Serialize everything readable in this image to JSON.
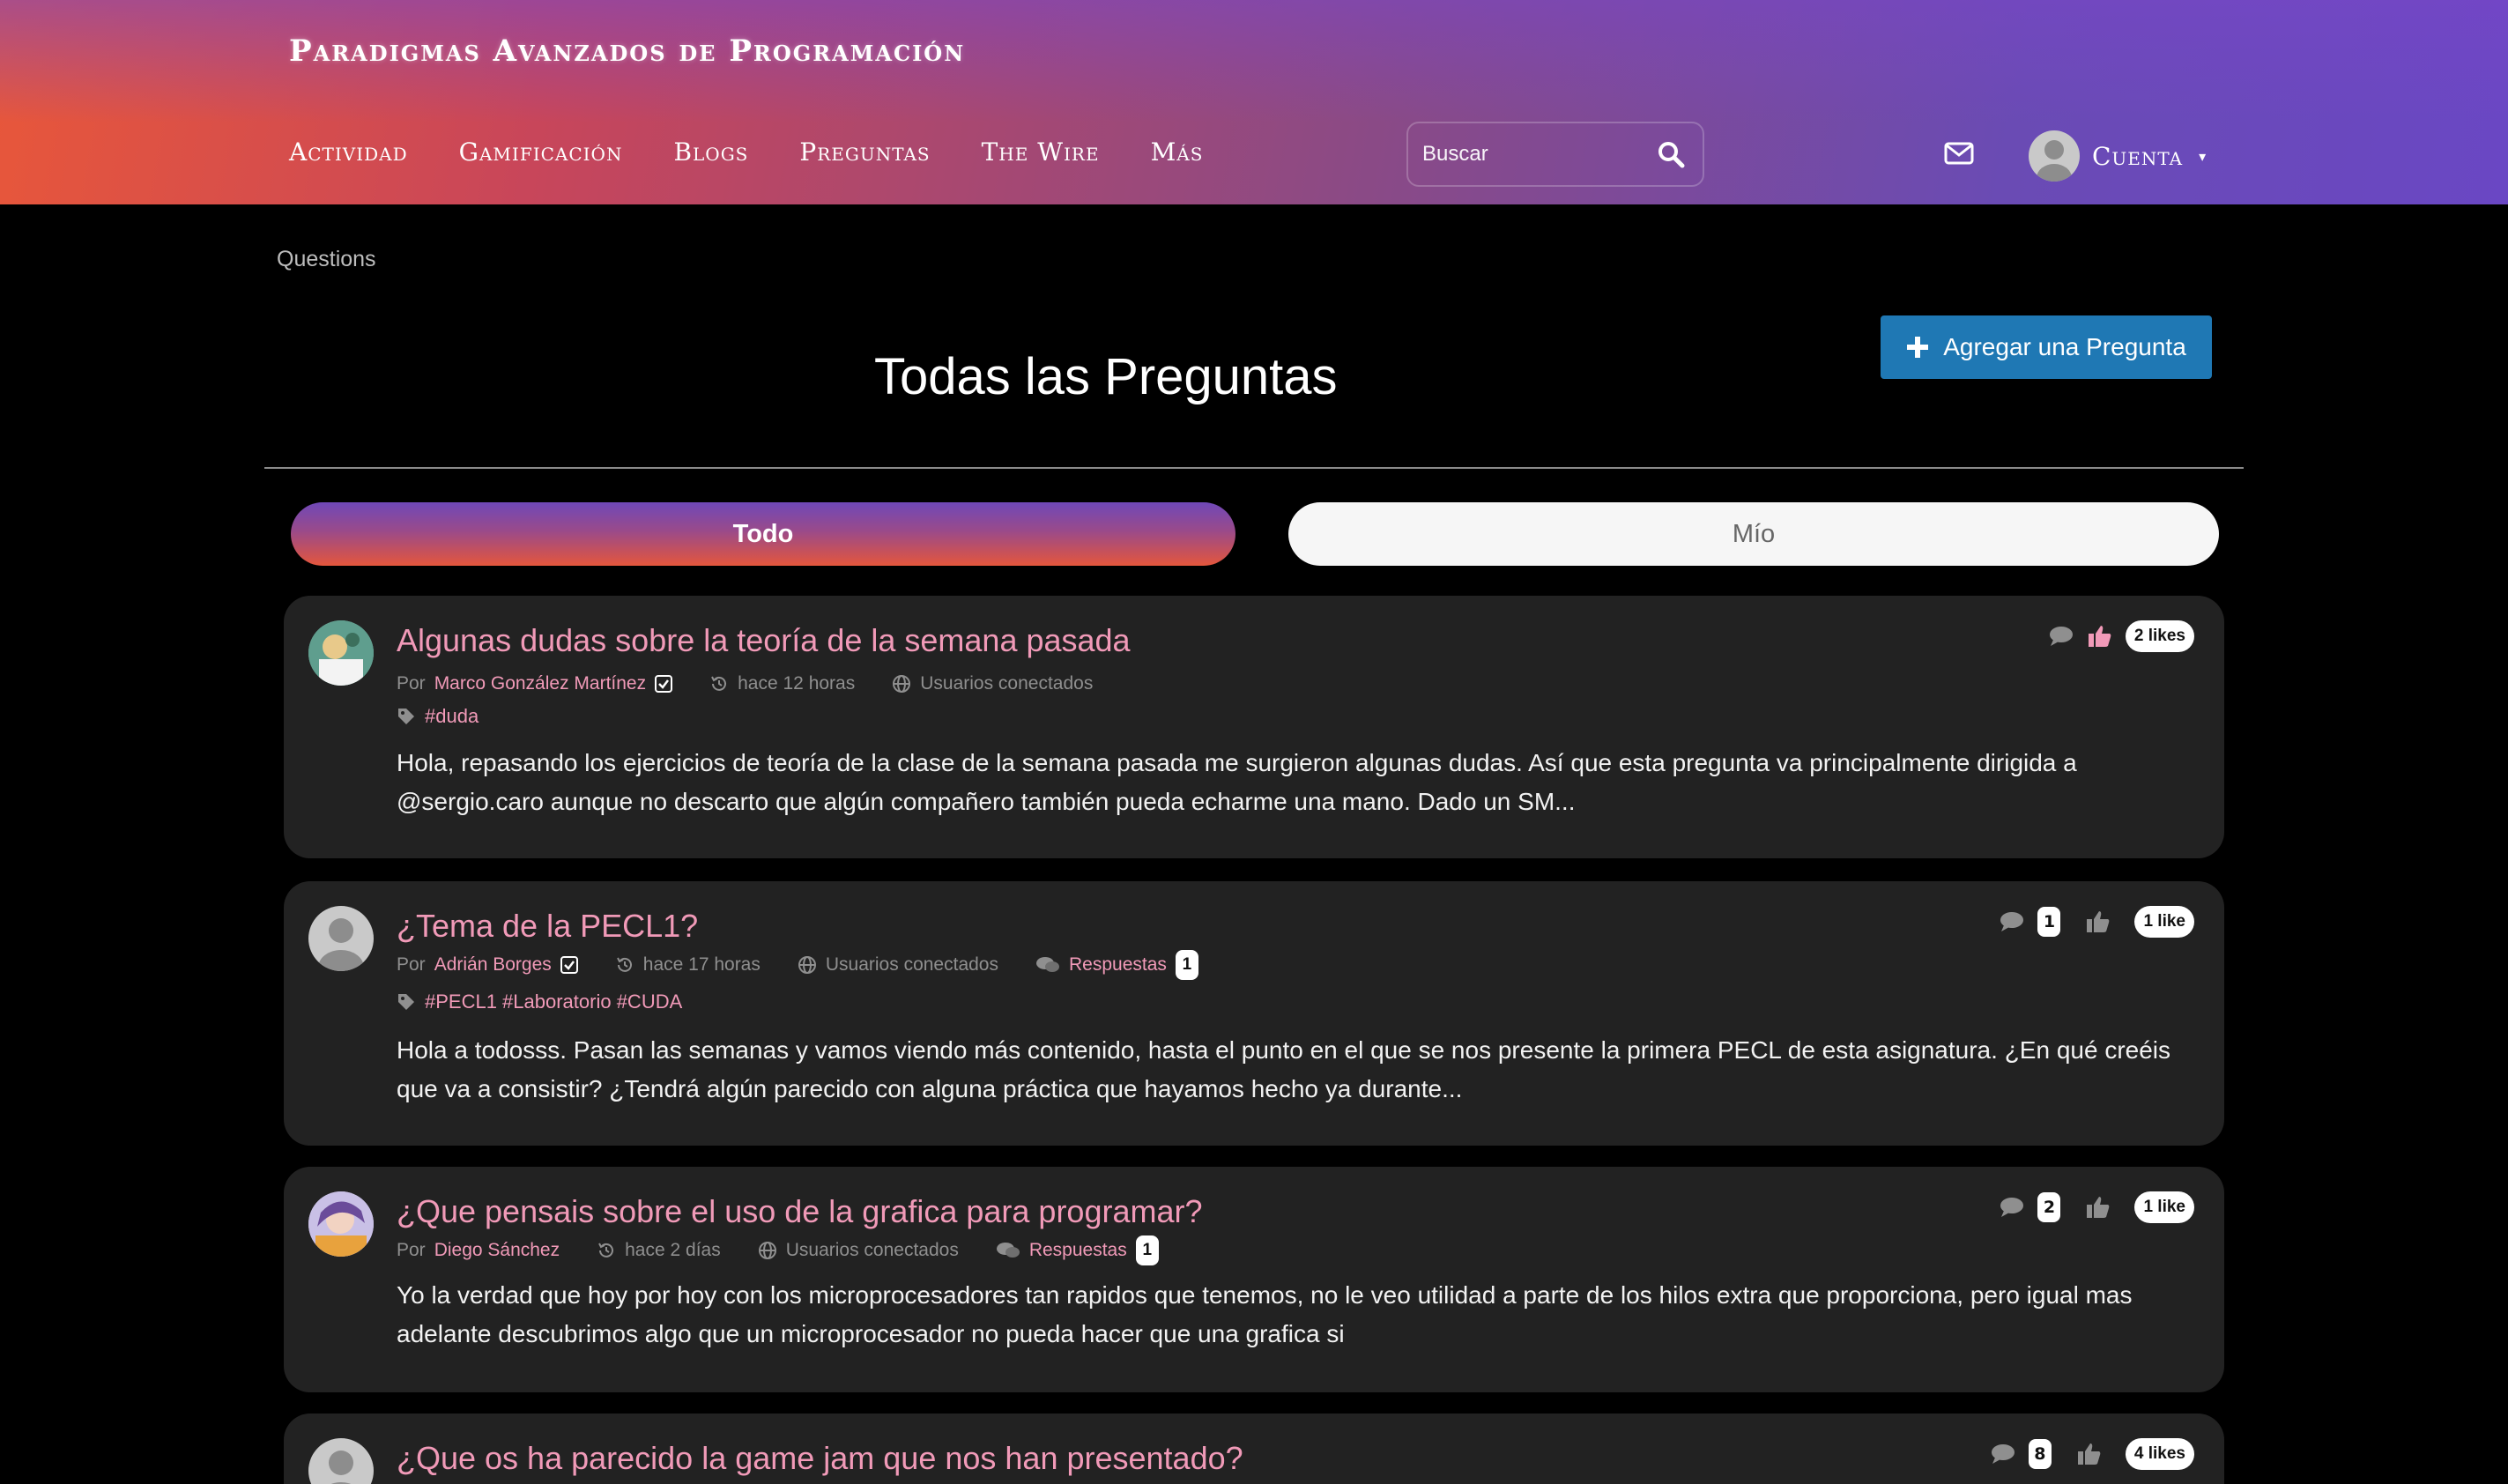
{
  "site": {
    "title": "Paradigmas Avanzados de Programación"
  },
  "nav": [
    {
      "label": "Actividad"
    },
    {
      "label": "Gamificación"
    },
    {
      "label": "Blogs"
    },
    {
      "label": "Preguntas"
    },
    {
      "label": "The Wire"
    },
    {
      "label": "Más"
    }
  ],
  "search": {
    "placeholder": "Buscar"
  },
  "account": {
    "label": "Cuenta"
  },
  "breadcrumb": "Questions",
  "page": {
    "title": "Todas las Preguntas",
    "add_button": "Agregar una Pregunta",
    "tabs": {
      "all": "Todo",
      "mine": "Mío"
    }
  },
  "questions": [
    {
      "title": "Algunas dudas sobre la teoría de la semana pasada",
      "by": "Por",
      "author": "Marco González Martínez",
      "time": "hace 12 horas",
      "visibility": "Usuarios conectados",
      "tags": "#duda",
      "excerpt": "Hola, repasando los ejercicios de teoría de la clase de la semana pasada me surgieron algunas dudas. Así que esta pregunta va principalmente dirigida a @sergio.caro aunque no descarto que algún compañero también pueda echarme una mano. Dado un SM...",
      "likes": "2 likes"
    },
    {
      "title": "¿Tema de la PECL1?",
      "by": "Por",
      "author": "Adrián Borges",
      "time": "hace 17 horas",
      "visibility": "Usuarios conectados",
      "answers_label": "Respuestas",
      "answers_count": "1",
      "tags": "#PECL1 #Laboratorio #CUDA",
      "excerpt": "Hola a todosss. Pasan las semanas y vamos viendo más contenido, hasta el punto en el que se nos presente la primera PECL de esta asignatura. ¿En qué creéis que va a consistir? ¿Tendrá algún parecido con alguna práctica que hayamos hecho ya durante...",
      "comments": "1",
      "likes": "1 like"
    },
    {
      "title": "¿Que pensais sobre el uso de la grafica para programar?",
      "by": "Por",
      "author": "Diego Sánchez",
      "time": "hace 2 días",
      "visibility": "Usuarios conectados",
      "answers_label": "Respuestas",
      "answers_count": "1",
      "excerpt": "Yo la verdad que hoy por hoy con los microprocesadores tan rapidos que tenemos, no le veo utilidad a parte de los hilos extra que proporciona, pero igual mas adelante descubrimos algo que un microprocesador no pueda hacer que una grafica si",
      "comments": "2",
      "likes": "1 like"
    },
    {
      "title": "¿Que os ha parecido la game jam que nos han presentado?",
      "comments": "8",
      "likes": "4 likes"
    }
  ],
  "colors": {
    "accent_pink": "#f19ab8",
    "button_blue": "#1f78b4",
    "card_bg": "#222222",
    "page_bg": "#000000"
  },
  "icons": [
    "search-icon",
    "mail-icon",
    "user-avatar-icon",
    "chevron-down-icon",
    "plus-icon",
    "comment-icon",
    "thumbs-up-icon",
    "history-icon",
    "globe-icon",
    "tag-icon",
    "verified-check-icon",
    "comments-icon"
  ]
}
